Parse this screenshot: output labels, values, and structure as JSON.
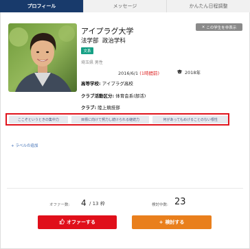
{
  "tabs": [
    {
      "label": "プロフィール"
    },
    {
      "label": "メッセージ"
    },
    {
      "label": "かんたん日程調整"
    }
  ],
  "profile": {
    "university": "アイプラグ大学",
    "faculty": "法学部",
    "department": "政治学科",
    "category_badge": "文系",
    "prefecture_gender": "埼玉県 男性",
    "hide_button": "この学生を非表示",
    "date": "2016/6/1",
    "login_status": "(1時間前)",
    "graduation": "2018年",
    "high_school_label": "高等学校:",
    "high_school": "アイプラグ高校",
    "club_category_label": "クラブ活動区分:",
    "club_category": "体育会系(部活)",
    "club_label": "クラブ:",
    "club": "陸上競技部"
  },
  "strength_tags": [
    "ここぞというときの集中力",
    "目標に向けて努力し続けられる継続力",
    "何があってもめげることのない根性"
  ],
  "add_label": "+ ラベルの追加",
  "stats": {
    "offer_label": "オファー数:",
    "offer_count": "4",
    "offer_total": "/ 13 枠",
    "review_label": "検討中数:",
    "review_count": "23"
  },
  "actions": {
    "offer_button": "オファーする",
    "review_button": "検討する"
  },
  "colors": {
    "tab_active": "#183a6b",
    "offer": "#e00f1a",
    "review": "#e97f1c",
    "badge": "#16a085",
    "highlight_border": "#e0121b"
  }
}
